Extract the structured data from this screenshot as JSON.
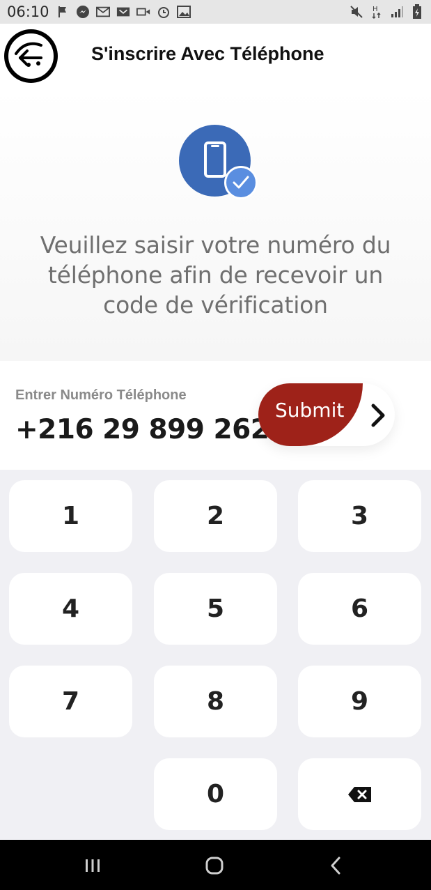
{
  "status_bar": {
    "time": "06:10",
    "icons_left": [
      "flag-icon",
      "messenger-icon",
      "gmail-icon",
      "missed-call-icon",
      "video-icon",
      "alarm-icon",
      "gallery-icon"
    ],
    "icons_right": [
      "mute-icon",
      "data-icon",
      "signal-icon",
      "battery-icon"
    ]
  },
  "header": {
    "title": "S'inscrire Avec Téléphone",
    "back_icon": "back-arrow-icon"
  },
  "hero": {
    "icon": "phone-check-icon",
    "message": "Veuillez saisir votre numéro du téléphone  afin de recevoir  un code de vérification"
  },
  "phone_entry": {
    "label": "Entrer Numéro Téléphone",
    "value": "+216 29 899 262",
    "submit_label": "Submit",
    "submit_icon": "chevron-right-icon"
  },
  "keypad": {
    "keys": [
      "1",
      "2",
      "3",
      "4",
      "5",
      "6",
      "7",
      "8",
      "9",
      "0"
    ],
    "delete_icon": "backspace-icon"
  },
  "colors": {
    "accent": "#9e2219",
    "icon_blue": "#3b6ab7",
    "check_blue": "#5a8ee0",
    "keypad_bg": "#f0f0f4"
  }
}
